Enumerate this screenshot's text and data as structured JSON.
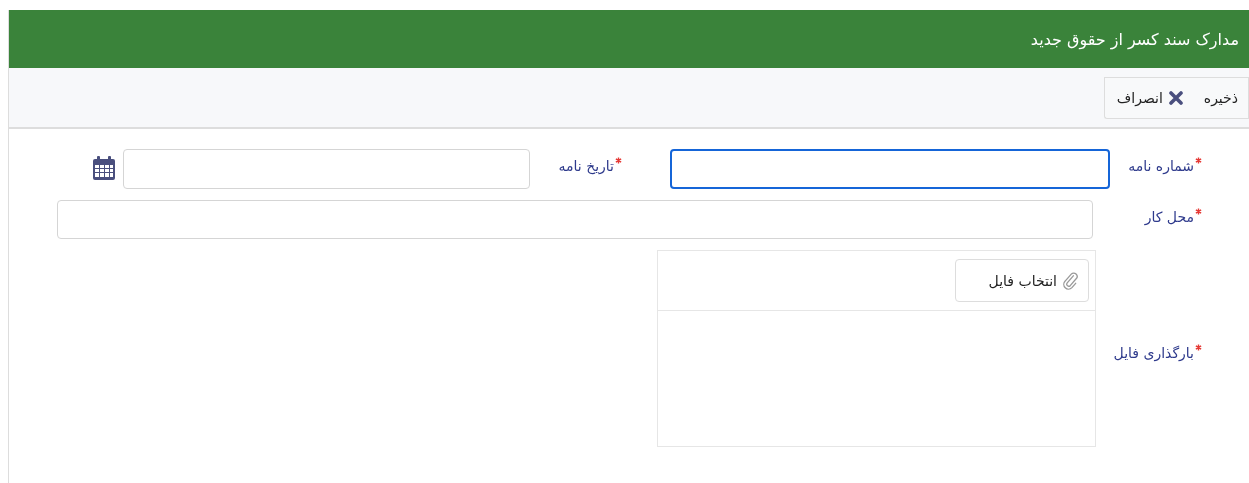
{
  "header": {
    "title": "مدارک سند کسر از حقوق جدید"
  },
  "toolbar": {
    "buttons": [
      {
        "label": "ذخیره",
        "kind": "save"
      },
      {
        "label": "انصراف",
        "kind": "cancel"
      }
    ]
  },
  "form": {
    "rows": [
      {
        "fields": [
          {
            "label": "شماره نامه",
            "required": true,
            "kind": "text",
            "focused": true
          },
          {
            "label": "تاریخ نامه",
            "required": true,
            "kind": "date",
            "focused": false
          }
        ]
      },
      {
        "fields": [
          {
            "label": "محل کار",
            "required": true,
            "kind": "wide",
            "focused": false
          }
        ]
      },
      {
        "fields": [
          {
            "label": "بارگذاری فایل",
            "required": true,
            "kind": "upload",
            "button": "انتخاب فایل"
          }
        ]
      }
    ]
  }
}
